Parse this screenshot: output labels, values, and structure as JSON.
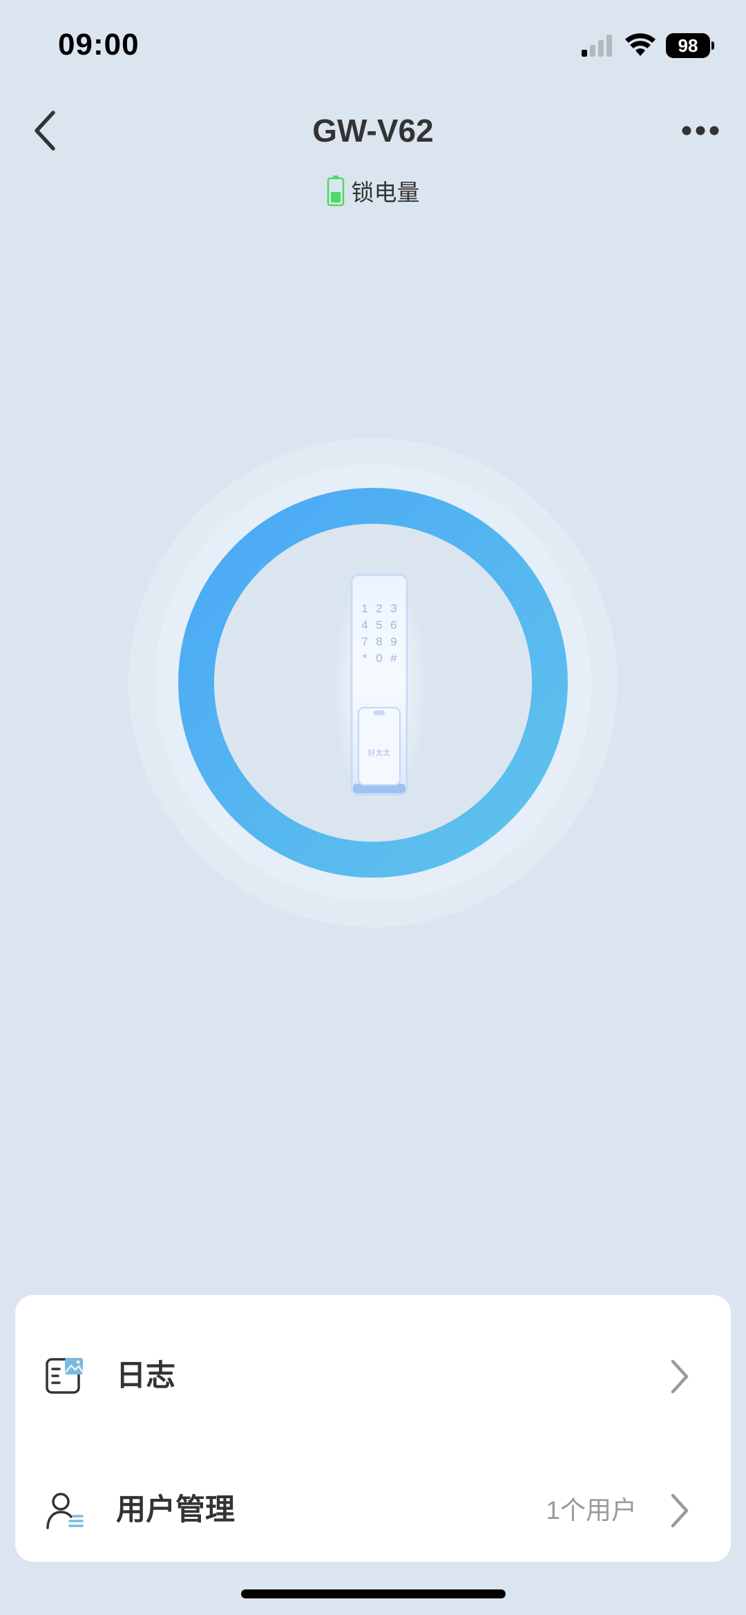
{
  "status_bar": {
    "time": "09:00",
    "battery_level": "98",
    "icons": [
      "cellular-signal-icon",
      "wifi-icon",
      "battery-icon"
    ]
  },
  "header": {
    "title": "GW-V62",
    "back_icon": "chevron-left-icon",
    "more_icon": "more-dots-icon"
  },
  "lock_status": {
    "battery_label": "锁电量",
    "battery_icon": "battery-vertical-icon",
    "battery_color": "#4cd964"
  },
  "lock_device": {
    "keypad_keys": [
      "1",
      "2",
      "3",
      "4",
      "5",
      "6",
      "7",
      "8",
      "9",
      "*",
      "0",
      "#"
    ],
    "brand_text": "好太太",
    "ring_gradient": [
      "#4aa8f5",
      "#5fc3ec"
    ]
  },
  "menu": {
    "logs": {
      "label": "日志",
      "icon": "log-icon"
    },
    "users": {
      "label": "用户管理",
      "value": "1个用户",
      "icon": "user-management-icon"
    }
  },
  "colors": {
    "background": "#dbe5ef",
    "card": "#ffffff",
    "accent": "#4aa8f5"
  }
}
